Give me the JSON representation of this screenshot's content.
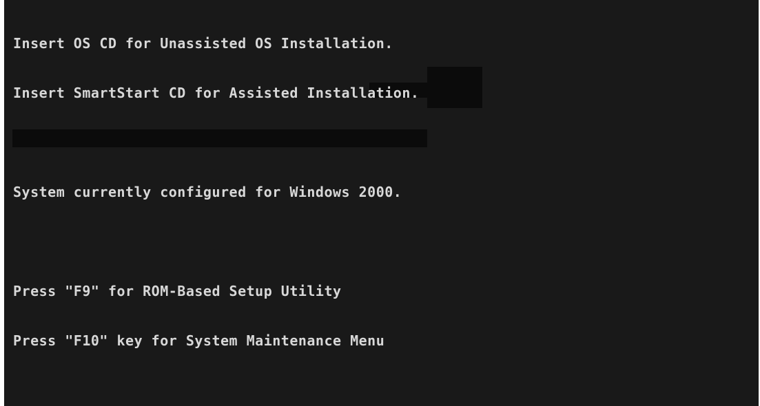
{
  "bios": {
    "line_os_cd": "Insert OS CD for Unassisted OS Installation.",
    "line_smartstart_cd": "Insert SmartStart CD for Assisted Installation.",
    "line_configured": "System currently configured for Windows 2000.",
    "line_f9": "Press \"F9\" for ROM-Based Setup Utility",
    "line_f10": "Press \"F10\" key for System Maintenance Menu"
  },
  "colors": {
    "background": "#191919",
    "text": "#d8d8d8",
    "black_blocks": "#0b0b0b"
  }
}
